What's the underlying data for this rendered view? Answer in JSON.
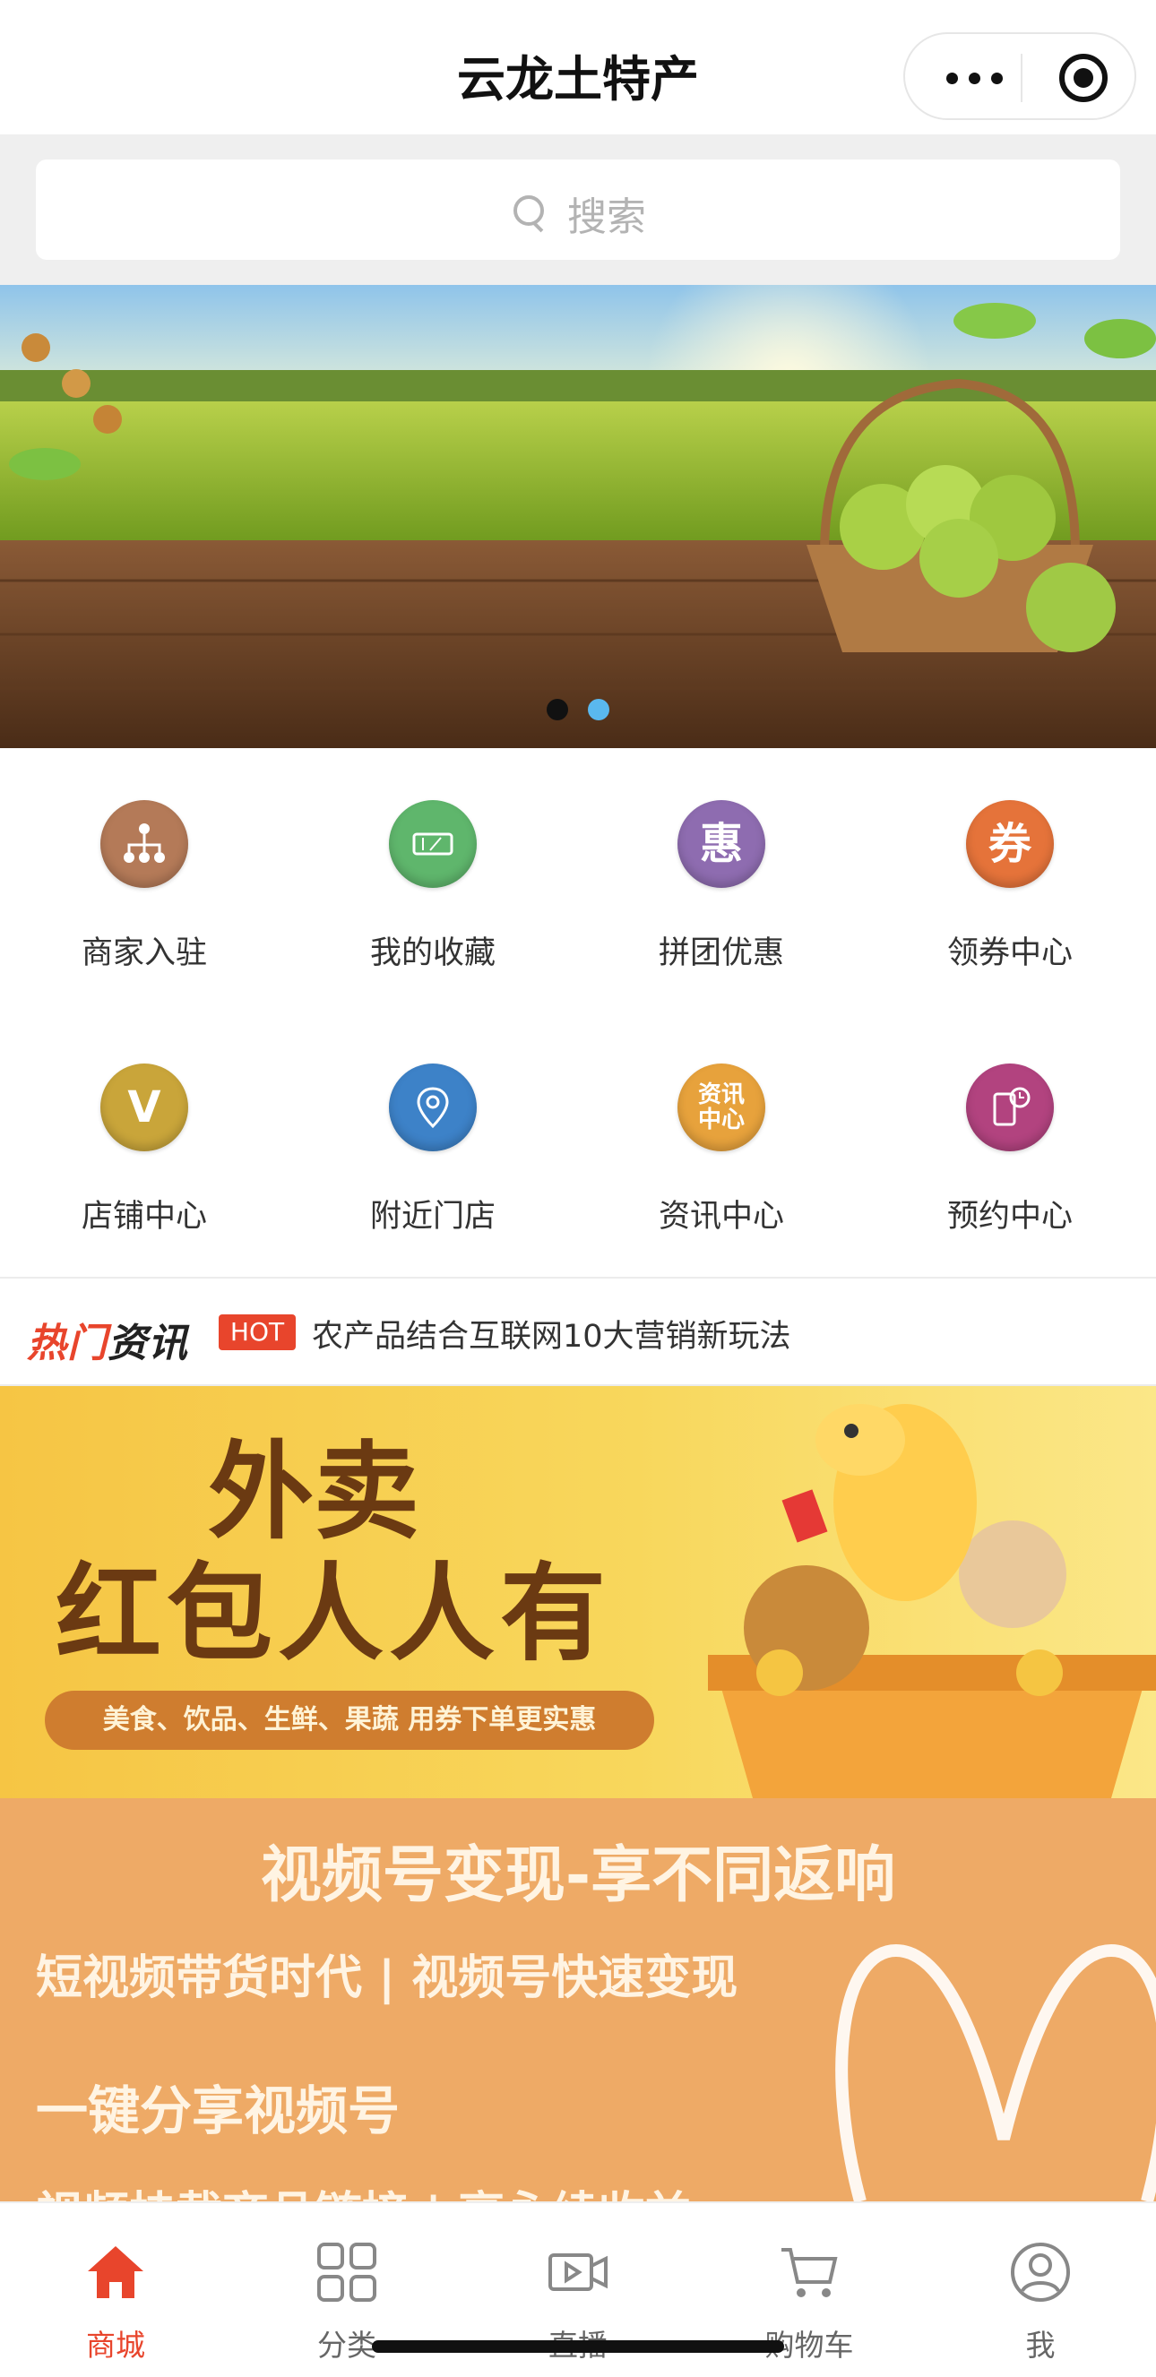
{
  "header": {
    "title": "云龙土特产",
    "capsule": {
      "more": "more-dots-icon",
      "close": "target-icon"
    }
  },
  "search": {
    "placeholder": "搜索",
    "icon": "search-icon"
  },
  "banner": {
    "slides": 2,
    "active_index": 1,
    "indicator_colors": {
      "inactive": "#111111",
      "active": "#5ab8ee"
    }
  },
  "grid": {
    "items": [
      {
        "label": "商家入驻",
        "icon": "org-chart-icon",
        "color": "#b47a58"
      },
      {
        "label": "我的收藏",
        "icon": "ticket-icon",
        "color": "#5fb66c"
      },
      {
        "label": "拼团优惠",
        "icon": "惠",
        "color": "#8e6cb0"
      },
      {
        "label": "领券中心",
        "icon": "券",
        "color": "#e5733a"
      },
      {
        "label": "店铺中心",
        "icon": "V",
        "color": "#c9a53a"
      },
      {
        "label": "附近门店",
        "icon": "location-pin-icon",
        "color": "#3d82c8"
      },
      {
        "label": "资讯中心",
        "icon": "资讯 中心",
        "color": "#e7a23c"
      },
      {
        "label": "预约中心",
        "icon": "phone-clock-icon",
        "color": "#b2437f"
      }
    ]
  },
  "news": {
    "logo_a": "热门",
    "logo_b": "资讯",
    "badge": "HOT",
    "headline": "农产品结合互联网10大营销新玩法"
  },
  "promo_takeout": {
    "line1": "外卖",
    "line2": "红包人人有",
    "pill": "美食、饮品、生鲜、果蔬 用券下单更实惠"
  },
  "promo_video": {
    "heading": "视频号变现-享不同返响",
    "line1": "短视频带货时代 | 视频号快速变现",
    "line2": "一键分享视频号",
    "line3": "视频挂载商品链接 | 享永续收益"
  },
  "tabbar": {
    "active": "商城",
    "tabs": [
      {
        "label": "商城",
        "icon": "home-icon"
      },
      {
        "label": "分类",
        "icon": "grid-icon"
      },
      {
        "label": "直播",
        "icon": "video-icon"
      },
      {
        "label": "购物车",
        "icon": "cart-icon"
      },
      {
        "label": "我",
        "icon": "user-icon"
      }
    ],
    "active_color": "#e8452c"
  }
}
